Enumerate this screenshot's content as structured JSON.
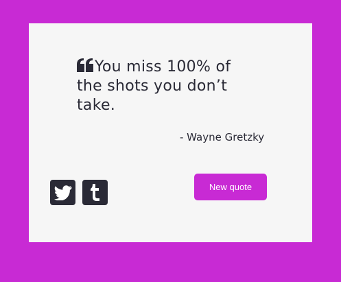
{
  "colors": {
    "background": "#c82ad4",
    "card": "#f6f6f6",
    "text": "#2a2a36",
    "accent": "#c82ad4",
    "button_text": "#ffffff"
  },
  "quote": {
    "icon": "quote-left-icon",
    "text": "You miss 100% of the shots you don’t take.",
    "author": "- Wayne Gretzky"
  },
  "share": {
    "twitter_icon": "twitter-icon",
    "tumblr_icon": "tumblr-icon"
  },
  "actions": {
    "new_quote_label": "New quote"
  }
}
